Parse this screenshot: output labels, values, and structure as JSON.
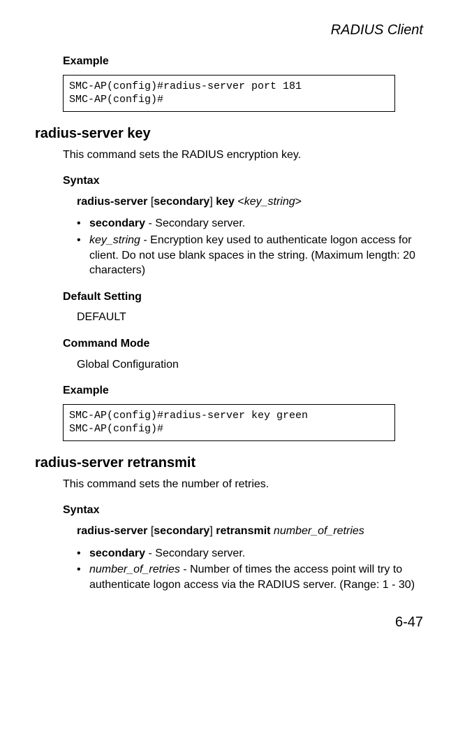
{
  "header": {
    "title": "RADIUS Client"
  },
  "section1": {
    "example_label": "Example",
    "code": "SMC-AP(config)#radius-server port 181\nSMC-AP(config)#"
  },
  "section2": {
    "heading": "radius-server key",
    "description": "This command sets the RADIUS encryption key.",
    "syntax_label": "Syntax",
    "syntax_html": "<span class=\"b\">radius-server</span> [<span class=\"b\">secondary</span>] <span class=\"b\">key</span> &lt;<span class=\"i\">key_string</span>&gt;",
    "bullets": [
      "<span class=\"b\">secondary</span> - Secondary server.",
      "<span class=\"i\">key_string</span> - Encryption key used to authenticate logon access for client. Do not use blank spaces in the string. (Maximum length: 20 characters)"
    ],
    "default_label": "Default Setting",
    "default_value": "DEFAULT",
    "mode_label": "Command Mode",
    "mode_value": "Global Configuration",
    "example_label": "Example",
    "code": "SMC-AP(config)#radius-server key green\nSMC-AP(config)#"
  },
  "section3": {
    "heading": "radius-server retransmit",
    "description": "This command sets the number of retries.",
    "syntax_label": "Syntax",
    "syntax_html": "<span class=\"b\">radius-server</span> [<span class=\"b\">secondary</span>] <span class=\"b\">retransmit</span> <span class=\"i\">number_of_retries</span>",
    "bullets": [
      "<span class=\"b\">secondary</span> - Secondary server.",
      "<span class=\"i\">number_of_retries</span> - Number of times the access point will try to authenticate logon access via the RADIUS server. (Range: 1 - 30)"
    ]
  },
  "footer": {
    "page": "6-47"
  }
}
